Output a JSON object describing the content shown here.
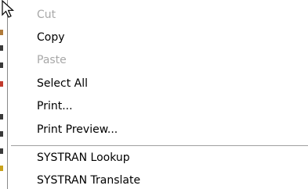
{
  "context_menu": {
    "items": [
      {
        "label": "Cut",
        "enabled": false
      },
      {
        "label": "Copy",
        "enabled": true
      },
      {
        "label": "Paste",
        "enabled": false
      },
      {
        "label": "Select All",
        "enabled": true
      },
      {
        "label": "Print...",
        "enabled": true
      },
      {
        "label": "Print Preview...",
        "enabled": true
      },
      {
        "label": "SYSTRAN Lookup",
        "enabled": true
      },
      {
        "label": "SYSTRAN Translate",
        "enabled": true
      }
    ]
  },
  "cursor": {
    "icon": "arrow-cursor-icon"
  },
  "colors": {
    "menu_background": "#ffffff",
    "enabled_text": "#000000",
    "disabled_text": "#a8a8a8",
    "separator": "#a0a0a0"
  }
}
